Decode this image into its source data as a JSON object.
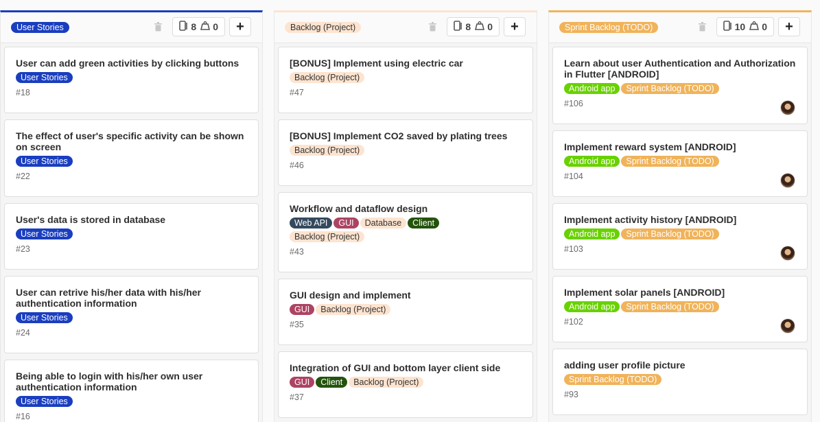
{
  "columns": [
    {
      "label": "User Stories",
      "issue_count": "8",
      "weight": "0",
      "cards": [
        {
          "title": "User can add green activities by clicking buttons",
          "labels": [
            "User Stories"
          ],
          "number": "#18"
        },
        {
          "title": "The effect of user's specific activity can be shown on screen",
          "labels": [
            "User Stories"
          ],
          "number": "#22"
        },
        {
          "title": "User's data is stored in database",
          "labels": [
            "User Stories"
          ],
          "number": "#23"
        },
        {
          "title": "User can retrive his/her data with his/her authentication information",
          "labels": [
            "User Stories"
          ],
          "number": "#24"
        },
        {
          "title": "Being able to login with his/her own user authentication information",
          "labels": [
            "User Stories"
          ],
          "number": "#16"
        }
      ]
    },
    {
      "label": "Backlog (Project)",
      "issue_count": "8",
      "weight": "0",
      "cards": [
        {
          "title": "[BONUS] Implement using electric car",
          "labels": [
            "Backlog (Project)"
          ],
          "number": "#47"
        },
        {
          "title": "[BONUS] Implement CO2 saved by plating trees",
          "labels": [
            "Backlog (Project)"
          ],
          "number": "#46"
        },
        {
          "title": "Workflow and dataflow design",
          "labels": [
            "Web API",
            "GUI",
            "Database",
            "Client"
          ],
          "labels2": [
            "Backlog (Project)"
          ],
          "number": "#43"
        },
        {
          "title": "GUI design and implement",
          "labels": [
            "GUI",
            "Backlog (Project)"
          ],
          "number": "#35"
        },
        {
          "title": "Integration of GUI and bottom layer client side",
          "labels": [
            "GUI",
            "Client",
            "Backlog (Project)"
          ],
          "number": "#37"
        }
      ]
    },
    {
      "label": "Sprint Backlog (TODO)",
      "issue_count": "10",
      "weight": "0",
      "cards": [
        {
          "title": "Learn about user Authentication and Authorization in Flutter [ANDROID]",
          "labels": [
            "Android app",
            "Sprint Backlog (TODO)"
          ],
          "number": "#106"
        },
        {
          "title": "Implement reward system [ANDROID]",
          "labels": [
            "Android app",
            "Sprint Backlog (TODO)"
          ],
          "number": "#104"
        },
        {
          "title": "Implement activity history [ANDROID]",
          "labels": [
            "Android app",
            "Sprint Backlog (TODO)"
          ],
          "number": "#103"
        },
        {
          "title": "Implement solar panels [ANDROID]",
          "labels": [
            "Android app",
            "Sprint Backlog (TODO)"
          ],
          "number": "#102"
        },
        {
          "title": "adding user profile picture",
          "labels": [
            "Sprint Backlog (TODO)"
          ],
          "number": "#93"
        }
      ]
    }
  ],
  "label_colors": {
    "User Stories": "#1a3ebf",
    "Backlog (Project)": "#fde4d0",
    "Sprint Backlog (TODO)": "#f0b35a",
    "Android app": "#69d100",
    "Web API": "#34495e",
    "GUI": "#ad4363",
    "Database": "#fde4d0",
    "Client": "#24530c"
  },
  "icons": {
    "delete": "trash-icon",
    "issues": "issues-icon",
    "weight": "weight-icon",
    "add": "plus-icon",
    "assignee": "avatar"
  }
}
